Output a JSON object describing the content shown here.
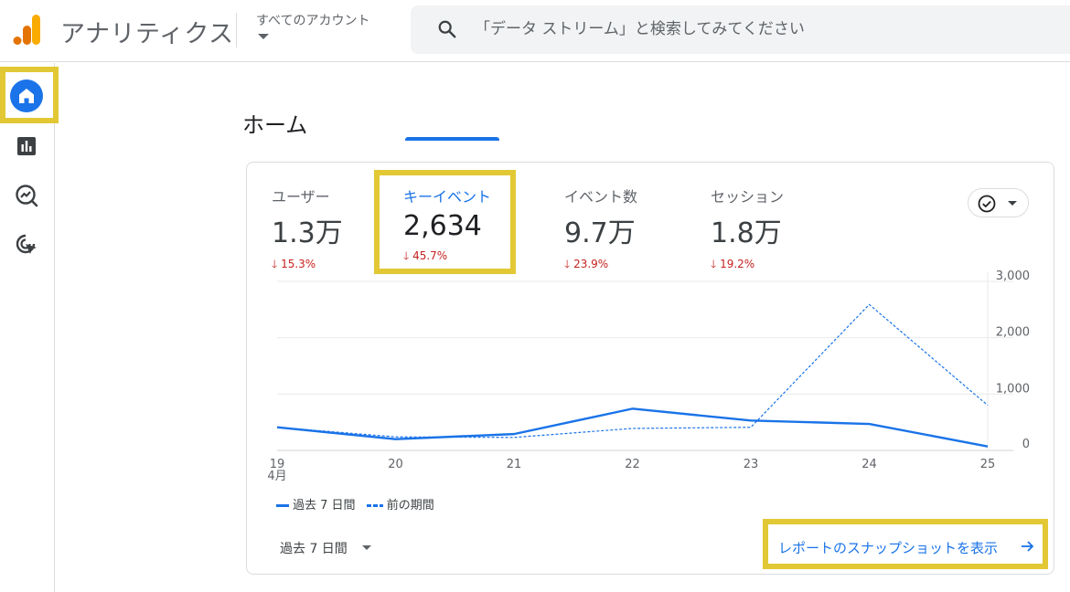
{
  "header": {
    "app_title": "アナリティクス",
    "account_label": "すべてのアカウント",
    "search_placeholder": "「データ ストリーム」と検索してみてください"
  },
  "rail": {
    "items": [
      {
        "name": "home",
        "icon": "home-icon",
        "active": true
      },
      {
        "name": "reports",
        "icon": "bar-chart-icon"
      },
      {
        "name": "explore",
        "icon": "explore-icon"
      },
      {
        "name": "advertising",
        "icon": "target-cursor-icon"
      }
    ]
  },
  "page": {
    "title": "ホーム"
  },
  "metrics": [
    {
      "label": "ユーザー",
      "value": "1.3万",
      "change": "15.3%",
      "direction": "down"
    },
    {
      "label": "キーイベント",
      "value": "2,634",
      "change": "45.7%",
      "direction": "down",
      "active": true
    },
    {
      "label": "イベント数",
      "value": "9.7万",
      "change": "23.9%",
      "direction": "down"
    },
    {
      "label": "セッション",
      "value": "1.8万",
      "change": "19.2%",
      "direction": "down"
    }
  ],
  "chart_data": {
    "type": "line",
    "x": [
      "19",
      "20",
      "21",
      "22",
      "23",
      "24",
      "25"
    ],
    "x_sublabel": "4月",
    "y_ticks": [
      "3,000",
      "2,000",
      "1,000",
      "0"
    ],
    "ylim": [
      0,
      3000
    ],
    "series": [
      {
        "name": "過去 7 日間",
        "style": "solid",
        "values": [
          410,
          200,
          290,
          740,
          530,
          470,
          70
        ]
      },
      {
        "name": "前の期間",
        "style": "dashed",
        "values": [
          410,
          240,
          230,
          390,
          410,
          2590,
          800
        ]
      }
    ],
    "grid": true,
    "legend_position": "bottom-left",
    "colors": {
      "line": "#1a73e8",
      "grid": "#e8eaed",
      "axis": "#dadce0"
    }
  },
  "footer": {
    "period_label": "過去 7 日間",
    "snapshot_link": "レポートのスナップショットを表示"
  },
  "colors": {
    "accent": "#1a73e8",
    "negative": "#c5221f",
    "highlight": "#e2c834"
  }
}
